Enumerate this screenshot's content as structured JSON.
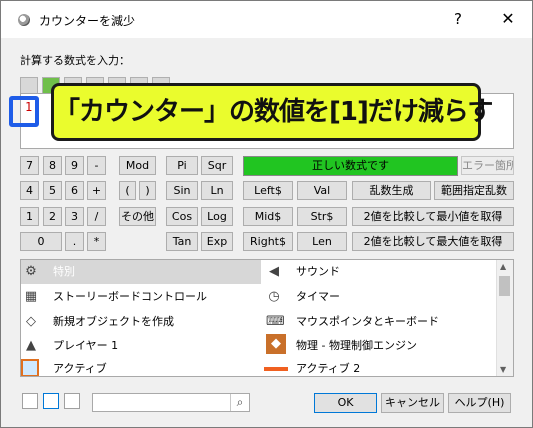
{
  "window": {
    "title": "カウンターを減少",
    "help_glyph": "?",
    "close_glyph": "✕"
  },
  "formula": {
    "label": "計算する数式を入力：",
    "value": "1"
  },
  "annotation": {
    "highlight_text": "「カウンター」の数値を[1]だけ減らす"
  },
  "keypad": {
    "k7": "7",
    "k8": "8",
    "k9": "9",
    "kminus": "-",
    "k4": "4",
    "k5": "5",
    "k6": "6",
    "kplus": "+",
    "k1": "1",
    "k2": "2",
    "k3": "3",
    "kdiv": "/",
    "k0": "0",
    "kdot": ".",
    "kmul": "*"
  },
  "functions": {
    "mod": "Mod",
    "lparen": "(",
    "rparen": ")",
    "other": "その他",
    "pi": "Pi",
    "sqr": "Sqr",
    "sin": "Sin",
    "ln": "Ln",
    "cos": "Cos",
    "log": "Log",
    "tan": "Tan",
    "exp": "Exp",
    "left": "Left$",
    "val": "Val",
    "rand": "乱数生成",
    "range_rand": "範囲指定乱数",
    "mid": "Mid$",
    "str": "Str$",
    "min2": "2値を比較して最小値を取得",
    "right": "Right$",
    "len": "Len",
    "max2": "2値を比較して最大値を取得"
  },
  "status": {
    "text": "正しい数式です",
    "error_button": "エラー箇所",
    "color": "#21c521"
  },
  "objects": [
    {
      "name": "特別",
      "icon": "gears-icon"
    },
    {
      "name": "サウンド",
      "icon": "speaker-icon"
    },
    {
      "name": "ストーリーボードコントロール",
      "icon": "checkered-flag-icon"
    },
    {
      "name": "タイマー",
      "icon": "timer-icon"
    },
    {
      "name": "新規オブジェクトを作成",
      "icon": "new-object-icon"
    },
    {
      "name": "マウスポインタとキーボード",
      "icon": "keyboard-icon"
    },
    {
      "name": "プレイヤー 1",
      "icon": "joystick-icon"
    },
    {
      "name": "物理 - 物理制御エンジン",
      "icon": "physics-icon"
    },
    {
      "name": "アクティブ",
      "icon": "active-object-icon"
    },
    {
      "name": "アクティブ 2",
      "icon": "active2-object-icon"
    }
  ],
  "footer": {
    "ok": "OK",
    "cancel": "キャンセル",
    "help": "ヘルプ(H)",
    "search_placeholder": ""
  },
  "colors": {
    "accent": "#1e5ce8",
    "annotation_bg": "#eafc2d",
    "status_ok": "#21c521"
  }
}
